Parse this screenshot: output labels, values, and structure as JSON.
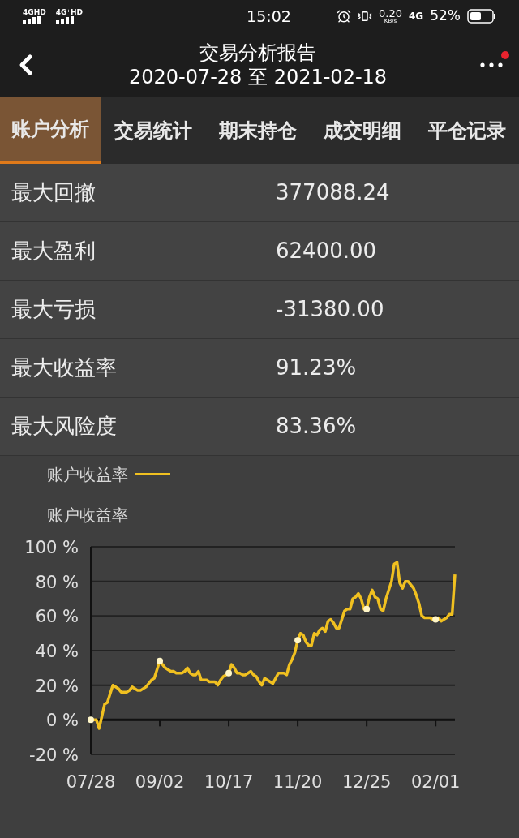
{
  "status_bar": {
    "signal_1": "4GHD",
    "signal_2": "4G⁺HD",
    "time": "15:02",
    "speed": "0.20",
    "speed_unit": "KB/s",
    "network": "4G",
    "battery": "52%"
  },
  "header": {
    "title": "交易分析报告",
    "subtitle": "2020-07-28 至 2021-02-18"
  },
  "tabs": [
    {
      "label": "账户分析",
      "selected": true
    },
    {
      "label": "交易统计",
      "selected": false
    },
    {
      "label": "期末持仓",
      "selected": false
    },
    {
      "label": "成交明细",
      "selected": false
    },
    {
      "label": "平仓记录",
      "selected": false
    }
  ],
  "stats": [
    {
      "label": "最大回撤",
      "value": "377088.24"
    },
    {
      "label": "最大盈利",
      "value": "62400.00"
    },
    {
      "label": "最大亏损",
      "value": "-31380.00"
    },
    {
      "label": "最大收益率",
      "value": "91.23%"
    },
    {
      "label": "最大风险度",
      "value": "83.36%"
    }
  ],
  "chart": {
    "chart_data": {
      "type": "line",
      "title": "账户收益率",
      "categories": [
        "07/28",
        null,
        null,
        null,
        null,
        null,
        null,
        null,
        null,
        null,
        null,
        null,
        null,
        null,
        null,
        null,
        null,
        null,
        null,
        null,
        null,
        null,
        null,
        null,
        null,
        "09/02",
        null,
        null,
        null,
        null,
        null,
        null,
        null,
        null,
        null,
        null,
        null,
        null,
        null,
        null,
        null,
        null,
        null,
        null,
        null,
        null,
        null,
        null,
        null,
        null,
        "10/17",
        null,
        null,
        null,
        null,
        null,
        null,
        null,
        null,
        null,
        null,
        null,
        null,
        null,
        null,
        null,
        null,
        null,
        null,
        null,
        null,
        null,
        null,
        null,
        null,
        "11/20",
        null,
        null,
        null,
        null,
        null,
        null,
        null,
        null,
        null,
        null,
        null,
        null,
        null,
        null,
        null,
        null,
        null,
        null,
        null,
        null,
        null,
        null,
        null,
        null,
        "12/25",
        null,
        null,
        null,
        null,
        null,
        null,
        null,
        null,
        null,
        null,
        null,
        null,
        null,
        null,
        null,
        null,
        null,
        null,
        null,
        null,
        null,
        null,
        null,
        null,
        "02/01",
        null,
        null,
        null,
        null,
        null,
        null,
        null
      ],
      "series": [
        {
          "name": "账户收益率",
          "color": "#f0c020",
          "values": [
            0,
            0,
            0,
            -5,
            2,
            9,
            10,
            15,
            20,
            19,
            18,
            16,
            16,
            16,
            17,
            19,
            18,
            17,
            17,
            18,
            19,
            21,
            23,
            24,
            29,
            34,
            32,
            30,
            29,
            28,
            28,
            27,
            27,
            27,
            28,
            30,
            27,
            26,
            26,
            28,
            23,
            23,
            23,
            22,
            22,
            22,
            20,
            23,
            25,
            26,
            27,
            32,
            30,
            27,
            27,
            26,
            26,
            27,
            28,
            26,
            25,
            22,
            20,
            24,
            23,
            22,
            21,
            24,
            27,
            27,
            27,
            26,
            32,
            35,
            39,
            46,
            50,
            49,
            45,
            43,
            43,
            50,
            49,
            52,
            53,
            51,
            57,
            58,
            56,
            53,
            53,
            58,
            63,
            64,
            64,
            70,
            71,
            73,
            70,
            64,
            64,
            71,
            75,
            71,
            70,
            64,
            63,
            70,
            75,
            80,
            90,
            91,
            79,
            76,
            80,
            80,
            78,
            76,
            72,
            67,
            60,
            59,
            59,
            59,
            58,
            58,
            59,
            57,
            58,
            59,
            61,
            61,
            84
          ]
        }
      ],
      "grid": true,
      "ylim": [
        -20,
        100
      ],
      "yticks": [
        {
          "value": 100,
          "label": "100 %"
        },
        {
          "value": 80,
          "label": "80 %"
        },
        {
          "value": 60,
          "label": "60 %"
        },
        {
          "value": 40,
          "label": "40 %"
        },
        {
          "value": 20,
          "label": "20 %"
        },
        {
          "value": 0,
          "label": "0 %"
        },
        {
          "value": -20,
          "label": "-20 %"
        }
      ]
    }
  }
}
